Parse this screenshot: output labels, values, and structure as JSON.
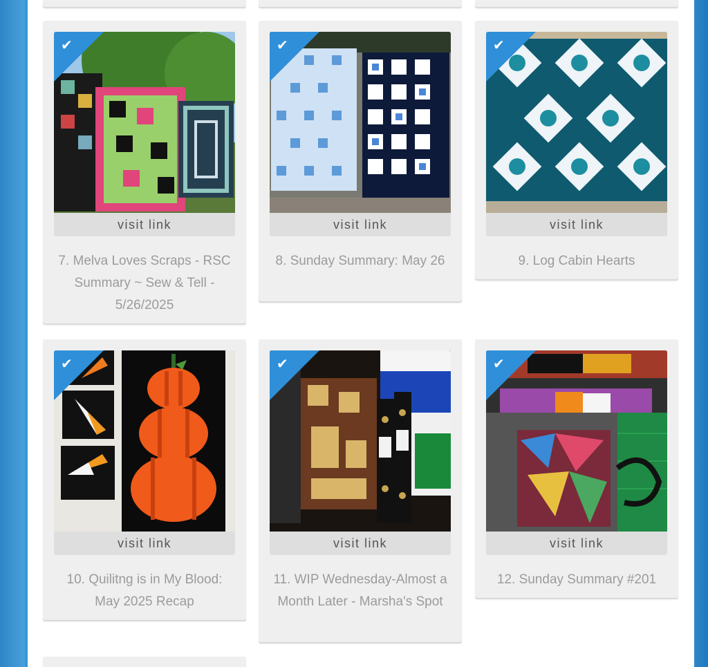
{
  "link_button_label": "visit link",
  "check_icon": "✔",
  "accent_color": "#2f8fd8",
  "links": [
    {
      "number": "7",
      "title": "7. Melva Loves Scraps - RSC Summary ~ Sew & Tell - 5/26/2025"
    },
    {
      "number": "8",
      "title": "8. Sunday Summary: May 26"
    },
    {
      "number": "9",
      "title": "9. Log Cabin Hearts"
    },
    {
      "number": "10",
      "title": "10. Quilitng is in My Blood: May 2025 Recap"
    },
    {
      "number": "11",
      "title": "11. WIP Wednesday-Almost a Month Later - Marsha's Spot"
    },
    {
      "number": "12",
      "title": "12. Sunday Summary #201"
    }
  ]
}
